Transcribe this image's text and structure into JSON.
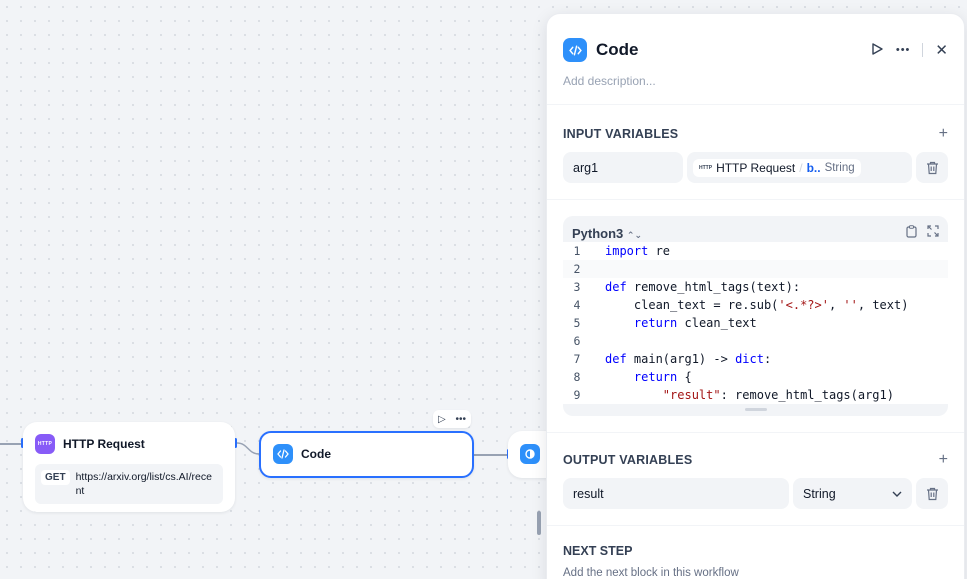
{
  "canvas": {
    "http_node": {
      "title": "HTTP Request",
      "icon_label": "HTTP",
      "method": "GET",
      "url": "https://arxiv.org/list/cs.AI/recent"
    },
    "code_node": {
      "title": "Code"
    },
    "next_node": {
      "icon": "llm-icon"
    }
  },
  "panel": {
    "title": "Code",
    "description_placeholder": "Add description...",
    "input_variables": {
      "title": "INPUT VARIABLES",
      "items": [
        {
          "name": "arg1",
          "source_node": "HTTP Request",
          "source_icon_label": "HTTP",
          "source_key": "b..",
          "source_type": "String"
        }
      ]
    },
    "editor": {
      "language": "Python3",
      "lines": [
        {
          "n": "1",
          "text": "import re"
        },
        {
          "n": "2",
          "text": ""
        },
        {
          "n": "3",
          "text": "def remove_html_tags(text):"
        },
        {
          "n": "4",
          "text": "    clean_text = re.sub('<.*?>', '', text)"
        },
        {
          "n": "5",
          "text": "    return clean_text"
        },
        {
          "n": "6",
          "text": ""
        },
        {
          "n": "7",
          "text": "def main(arg1) -> dict:"
        },
        {
          "n": "8",
          "text": "    return {"
        },
        {
          "n": "9",
          "text": "        \"result\": remove_html_tags(arg1)"
        }
      ]
    },
    "output_variables": {
      "title": "OUTPUT VARIABLES",
      "items": [
        {
          "name": "result",
          "type": "String"
        }
      ]
    },
    "next_step": {
      "title": "NEXT STEP",
      "description": "Add the next block in this workflow"
    }
  }
}
